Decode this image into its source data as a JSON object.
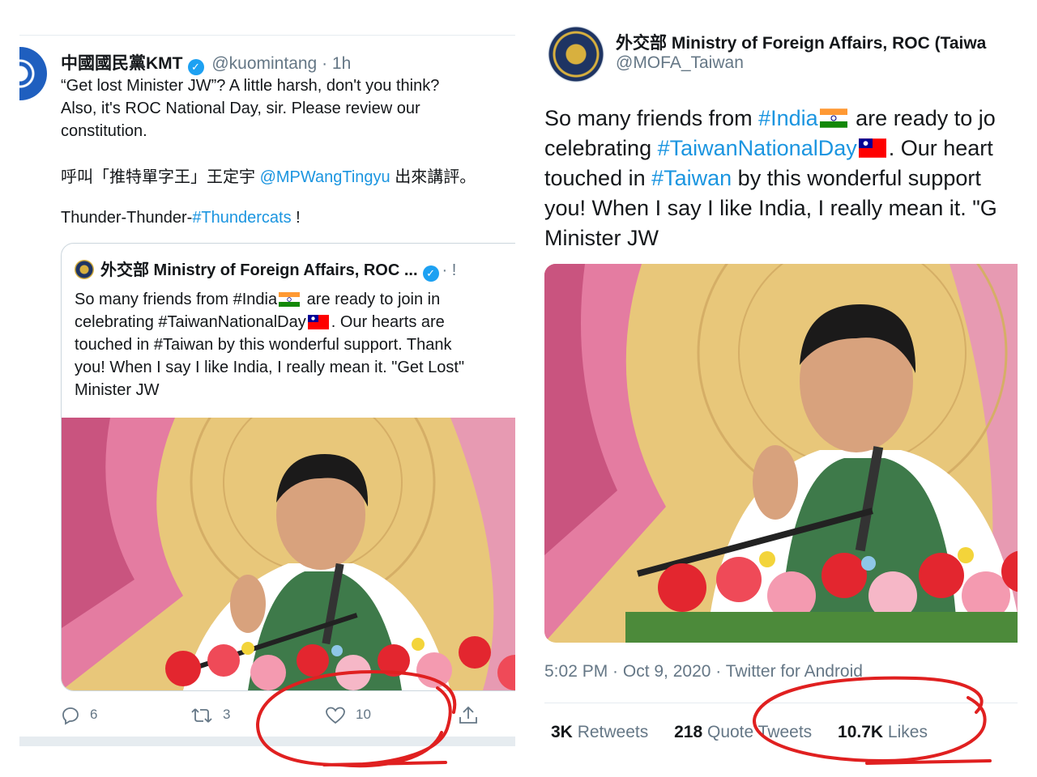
{
  "kmt_tweet": {
    "display_name": "中國國民黨KMT",
    "handle": "@kuomintang",
    "dot": "·",
    "time": "1h",
    "text_line1": "“Get lost Minister JW”? A little harsh, don't you think?",
    "text_line2": "Also, it's ROC National Day, sir. Please review our",
    "text_line3": "constitution.",
    "zh_prefix": "呼叫「推特單字王」王定宇 ",
    "zh_mention": "@MPWangTingyu",
    "zh_suffix": " 出來講評。",
    "thunder_prefix": "Thunder-Thunder-",
    "thunder_hashtag": "#Thundercats",
    "thunder_suffix": " !"
  },
  "quoted_tweet": {
    "name": "外交部 Ministry of Foreign Affairs, ROC ...",
    "dot": "· !",
    "line1a": "So many friends from #India",
    "line1b": " are ready to join in",
    "line2a": "celebrating #TaiwanNationalDay",
    "line2b": ". Our hearts are",
    "line3": "touched in #Taiwan by this wonderful support. Thank",
    "line4": "you! When I say I like India, I really mean it. \"Get Lost\"",
    "line5": "Minister JW"
  },
  "left_actions": {
    "reply_count": "6",
    "retweet_count": "3",
    "like_count": "10"
  },
  "mofa_tweet": {
    "display_name": "外交部 Ministry of Foreign Affairs, ROC (Taiwa",
    "handle": "@MOFA_Taiwan",
    "l1_pre": "So many friends from ",
    "l1_hash": "#India",
    "l1_post": " are ready to jo",
    "l2_pre": "celebrating ",
    "l2_hash": "#TaiwanNationalDay",
    "l2_post": ". Our heart",
    "l3_pre": "touched in ",
    "l3_hash": "#Taiwan",
    "l3_post": " by this wonderful support",
    "l4": "you! When I say I like India, I really mean it. \"G",
    "l5": "Minister JW",
    "timestamp": "5:02 PM · Oct 9, 2020 · Twitter for Android",
    "retweets_count": "3K",
    "retweets_label": "Retweets",
    "quote_count": "218",
    "quote_label": "Quote Tweets",
    "likes_count": "10.7K",
    "likes_label": "Likes"
  },
  "colors": {
    "link": "#1b95e0",
    "muted": "#657786",
    "verified": "#1da1f2",
    "annotation": "#e02020"
  }
}
